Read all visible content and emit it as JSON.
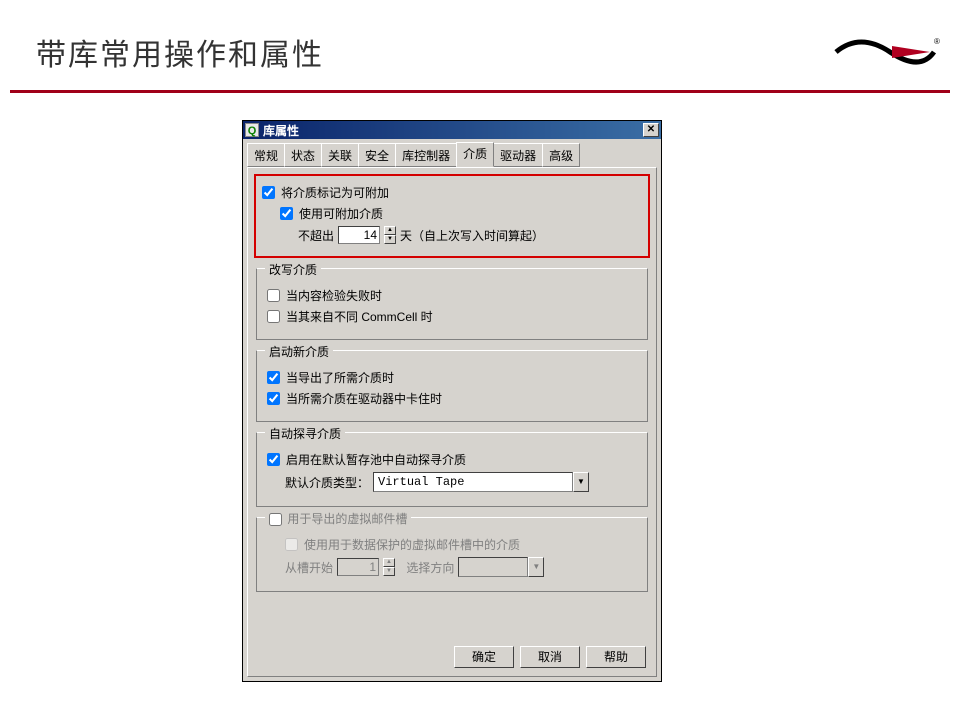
{
  "slide": {
    "title": "带库常用操作和属性"
  },
  "dialog": {
    "title": "库属性",
    "close_glyph": "✕",
    "tabs": [
      "常规",
      "状态",
      "关联",
      "安全",
      "库控制器",
      "介质",
      "驱动器",
      "高级"
    ],
    "active_tab_index": 5,
    "section_appendable": {
      "mark_label": "将介质标记为可附加",
      "mark_checked": true,
      "use_label": "使用可附加介质",
      "use_checked": true,
      "max_prefix": "不超出",
      "max_value": "14",
      "max_suffix": "天（自上次写入时间算起）"
    },
    "section_rewrite": {
      "legend": "改写介质",
      "content_fail_label": "当内容检验失败时",
      "content_fail_checked": false,
      "diff_commcell_label": "当其来自不同 CommCell 时",
      "diff_commcell_checked": false
    },
    "section_newmedia": {
      "legend": "启动新介质",
      "export_label": "当导出了所需介质时",
      "export_checked": true,
      "stuck_label": "当所需介质在驱动器中卡住时",
      "stuck_checked": true
    },
    "section_autodetect": {
      "legend": "自动探寻介质",
      "enable_label": "启用在默认暂存池中自动探寻介质",
      "enable_checked": true,
      "type_prefix": "默认介质类型：",
      "type_value": "Virtual Tape"
    },
    "section_virtualmail": {
      "legend": "用于导出的虚拟邮件槽",
      "legend_checked": false,
      "use_label": "使用用于数据保护的虚拟邮件槽中的介质",
      "use_checked": false,
      "slot_prefix": "从槽开始",
      "slot_value": "1",
      "direction_label": "选择方向"
    },
    "buttons": {
      "ok": "确定",
      "cancel": "取消",
      "help": "帮助"
    }
  }
}
